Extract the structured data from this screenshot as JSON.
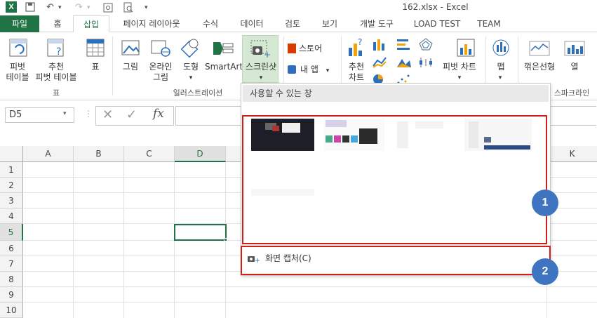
{
  "titlebar": {
    "title": "162.xlsx - Excel"
  },
  "tabs": [
    {
      "label": "파일"
    },
    {
      "label": "홈"
    },
    {
      "label": "삽입"
    },
    {
      "label": "페이지 레이아웃"
    },
    {
      "label": "수식"
    },
    {
      "label": "데이터"
    },
    {
      "label": "검토"
    },
    {
      "label": "보기"
    },
    {
      "label": "개발 도구"
    },
    {
      "label": "LOAD TEST"
    },
    {
      "label": "TEAM"
    }
  ],
  "ribbon": {
    "pivot_table": "피벗\n테이블",
    "recommended_pivot": "추천\n피벗 테이블",
    "table": "표",
    "group_table": "표",
    "picture": "그림",
    "online_picture": "온라인\n그림",
    "shapes": "도형",
    "smartart": "SmartArt",
    "screenshot": "스크린샷",
    "store": "스토어",
    "my_apps": "내 앱",
    "group_illustrations": "일러스트레이션",
    "recommended_charts": "추천\n차트",
    "pivot_chart": "피벗 차트",
    "map": "맵",
    "sparkline_line": "꺾은선형",
    "sparkline_column": "열",
    "group_sparklines": "스파크라인"
  },
  "formula_bar": {
    "name_box": "D5",
    "fx": "fx"
  },
  "grid": {
    "columns": [
      "A",
      "B",
      "C",
      "D",
      "K"
    ],
    "rows": [
      "1",
      "2",
      "3",
      "4",
      "5",
      "6",
      "7",
      "8",
      "9",
      "10"
    ],
    "active_cell": "D5"
  },
  "dropdown": {
    "header": "사용할 수 있는 창",
    "screen_clipping": "화면 캡처(C)"
  },
  "annotations": {
    "badge1": "1",
    "badge2": "2"
  },
  "colors": {
    "excel_green": "#217346",
    "highlight_red": "#d0201a",
    "badge_blue": "#3e74c0"
  }
}
